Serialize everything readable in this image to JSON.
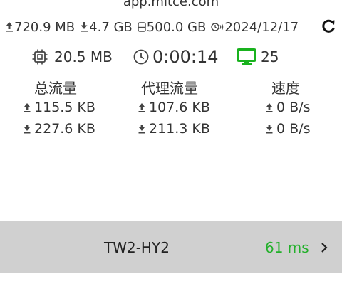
{
  "header": {
    "host": "app.mitce.com"
  },
  "subscription": {
    "upload": "720.9 MB",
    "download": "4.7 GB",
    "total": "500.0 GB",
    "expiry": "2024/12/17"
  },
  "stats": {
    "memory": "20.5 MB",
    "uptime": "0:00:14",
    "connections": "25"
  },
  "traffic": {
    "headers": [
      "总流量",
      "代理流量",
      "速度"
    ],
    "upload": [
      "115.5 KB",
      "107.6 KB",
      "0 B/s"
    ],
    "download": [
      "227.6 KB",
      "211.3 KB",
      "0 B/s"
    ]
  },
  "server": {
    "name": "TW2-HY2",
    "latency": "61 ms",
    "latency_color": "#22b02a"
  },
  "colors": {
    "monitor_icon": "#19b21e"
  },
  "icons": [
    "upload-icon",
    "download-icon",
    "storage-icon",
    "clock-expiry-icon",
    "refresh-icon",
    "cpu-icon",
    "clock-icon",
    "monitor-icon",
    "chevron-right-icon"
  ]
}
